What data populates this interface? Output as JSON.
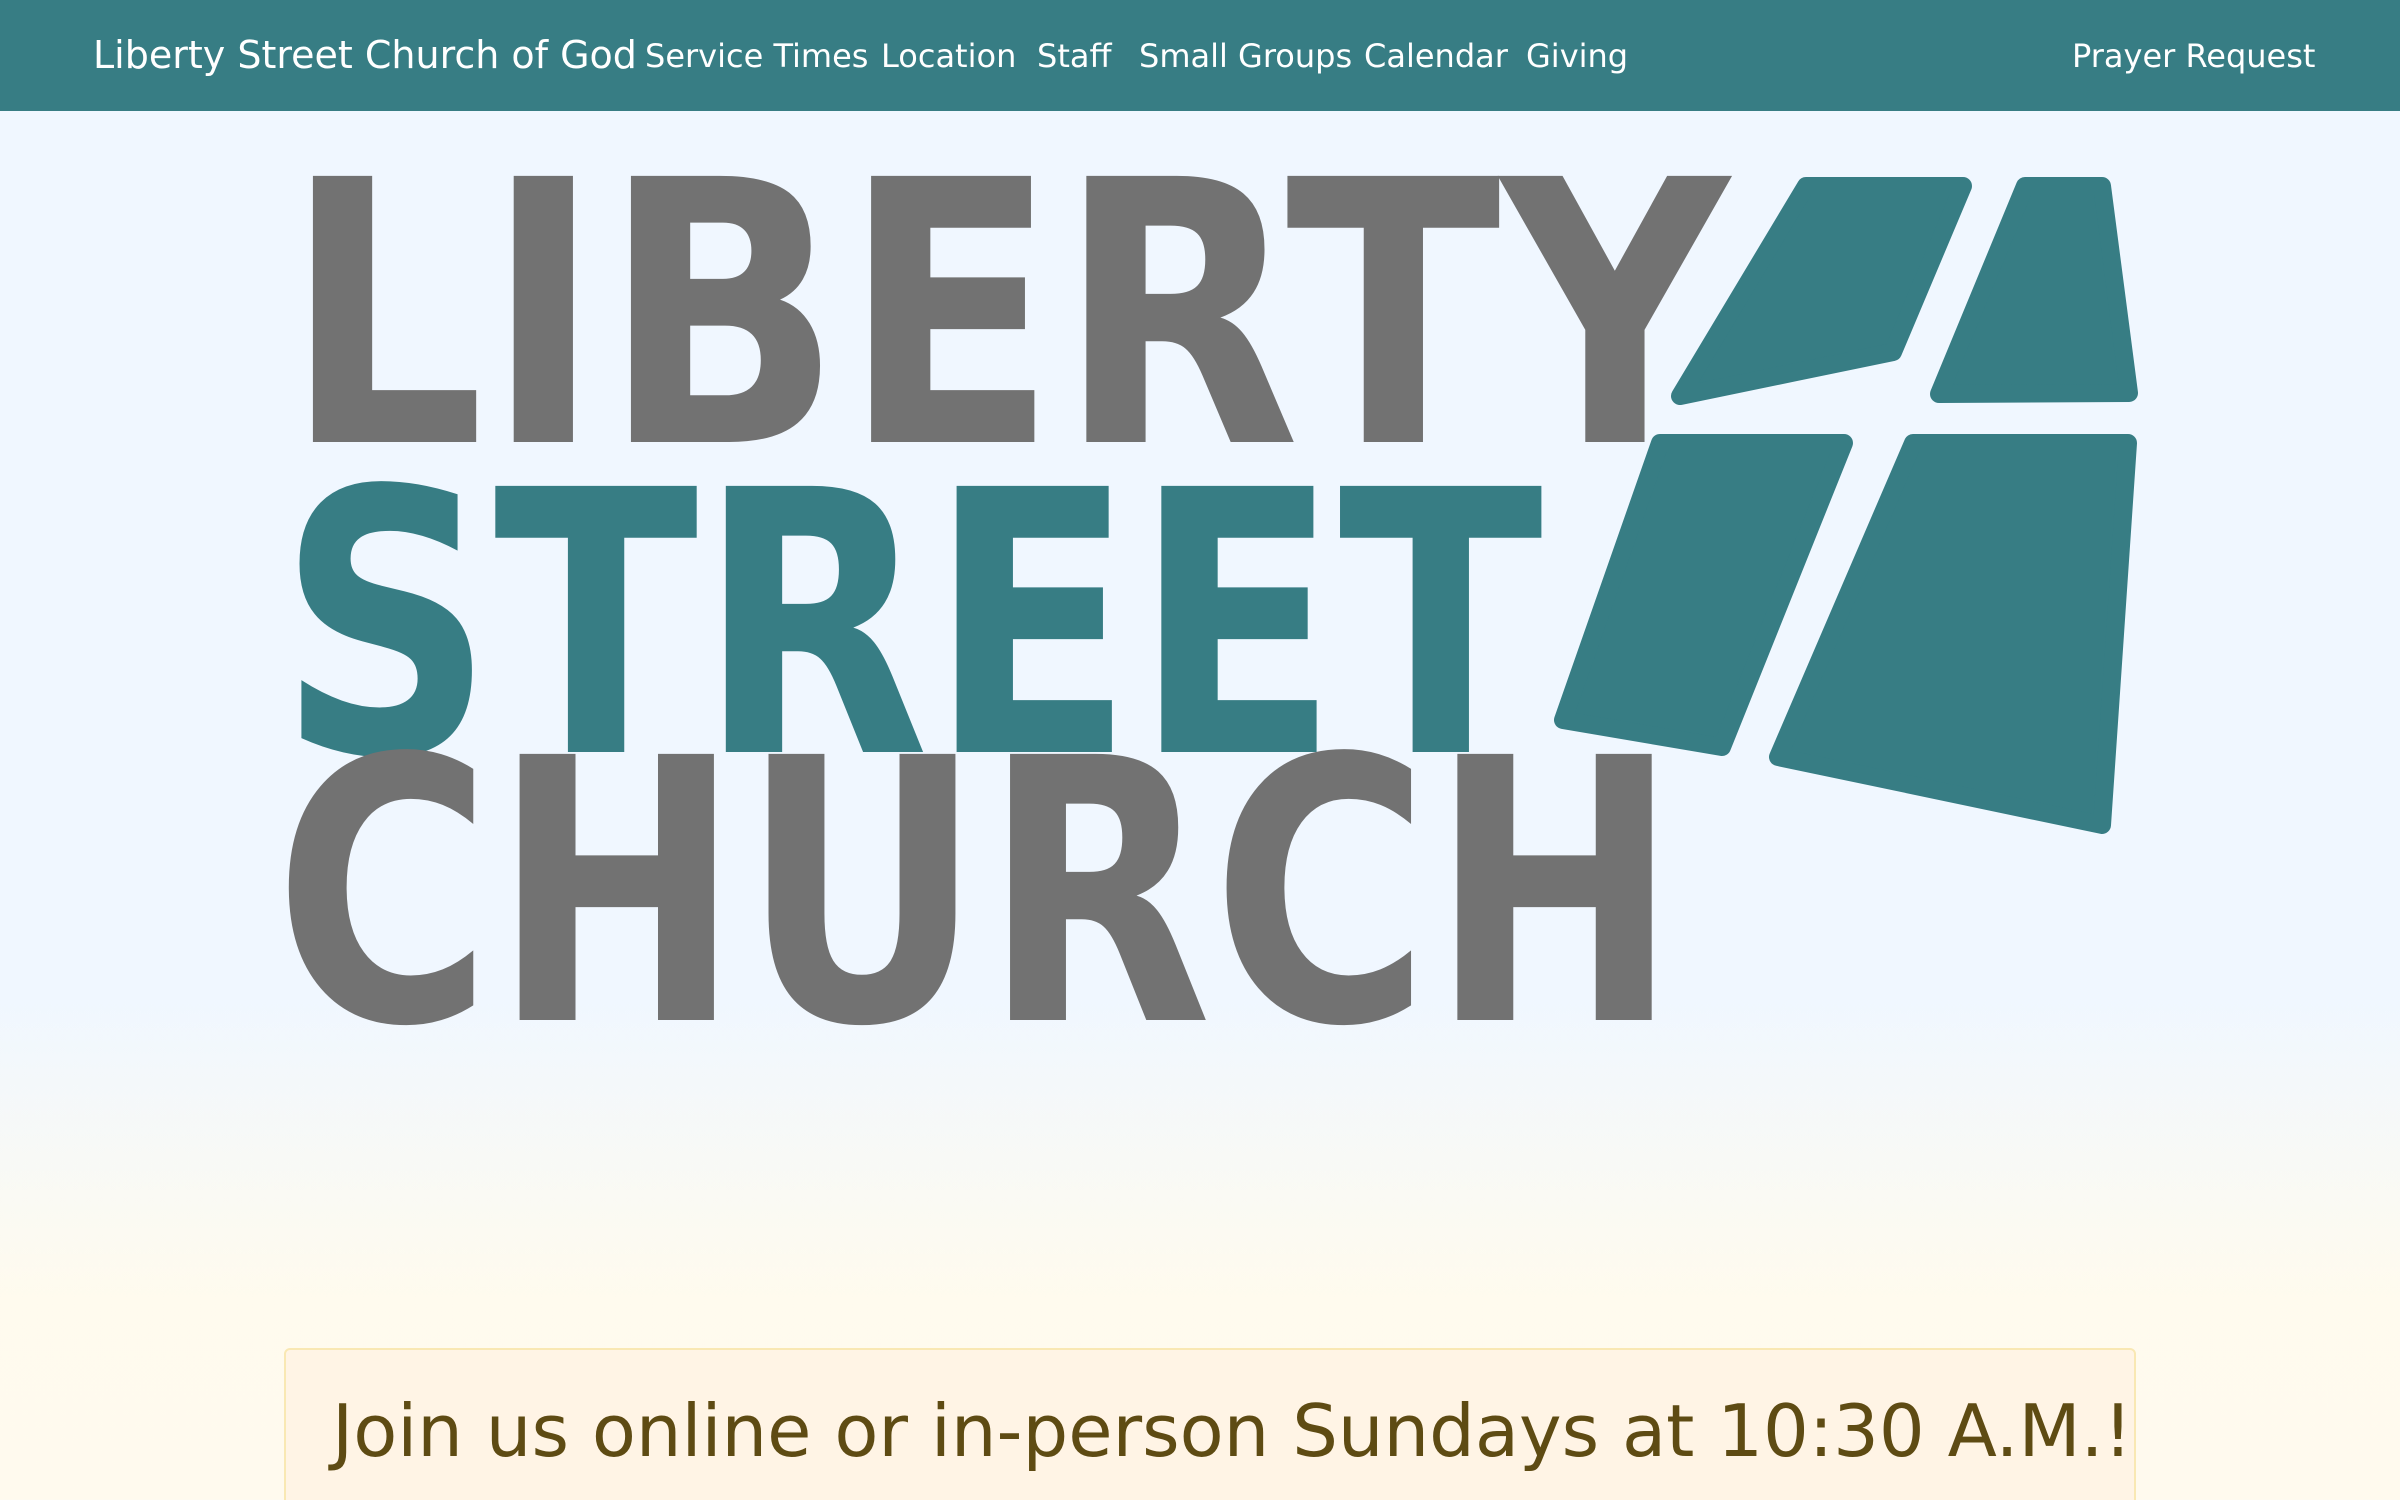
{
  "navbar": {
    "brand": "Liberty Street Church of God",
    "links": [
      {
        "label": "Service Times"
      },
      {
        "label": "Location"
      },
      {
        "label": "Staff"
      },
      {
        "label": "Small Groups"
      },
      {
        "label": "Calendar"
      },
      {
        "label": "Giving"
      }
    ],
    "right_link": "Prayer Request",
    "background_color": "#377d84"
  },
  "hero": {
    "logo": {
      "line1": "LIBERTY",
      "line2": "STREET",
      "line3": "CHURCH",
      "gray_color": "#727272",
      "teal_color": "#377d84",
      "mark_icon": "stained-glass-window-icon"
    }
  },
  "notice": {
    "text": "Join us online or in-person Sundays at 10:30 A.M.!",
    "text_color": "#5e4b13",
    "background_color": "#fff4e5"
  }
}
